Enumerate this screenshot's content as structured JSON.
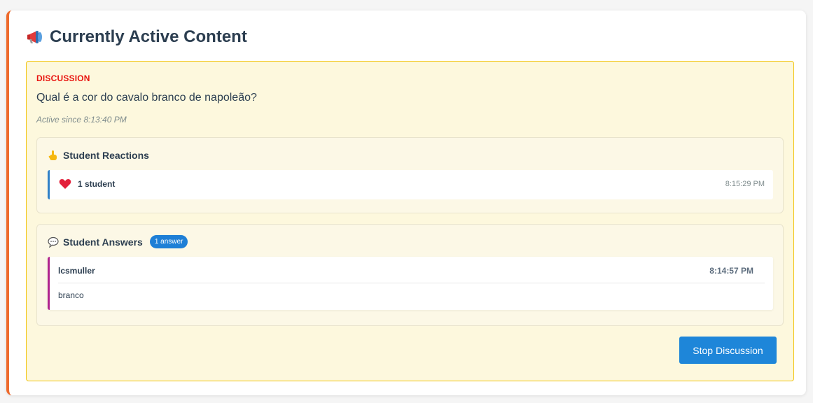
{
  "card": {
    "title": "Currently Active Content",
    "title_icon": "megaphone-icon"
  },
  "active": {
    "type_label": "DISCUSSION",
    "question": "Qual é a cor do cavalo branco de napoleão?",
    "active_since": "Active since 8:13:40 PM"
  },
  "reactions": {
    "title": "Student Reactions",
    "icon": "pointing-hand-icon",
    "items": [
      {
        "icon": "heart-icon",
        "count_label": "1 student",
        "time": "8:15:29 PM"
      }
    ]
  },
  "answers": {
    "title": "Student Answers",
    "icon": "speech-bubble-icon",
    "badge": "1 answer",
    "items": [
      {
        "user": "lcsmuller",
        "time": "8:14:57 PM",
        "text": "branco"
      }
    ]
  },
  "actions": {
    "stop_label": "Stop Discussion"
  },
  "colors": {
    "accent_border": "#ee6a2c",
    "active_bg": "#fdf8dd",
    "active_border": "#f1c40f",
    "type_label": "#e8140f",
    "button": "#1e86d9",
    "reaction_border": "#2f80c7",
    "answer_border": "#b0248e"
  }
}
